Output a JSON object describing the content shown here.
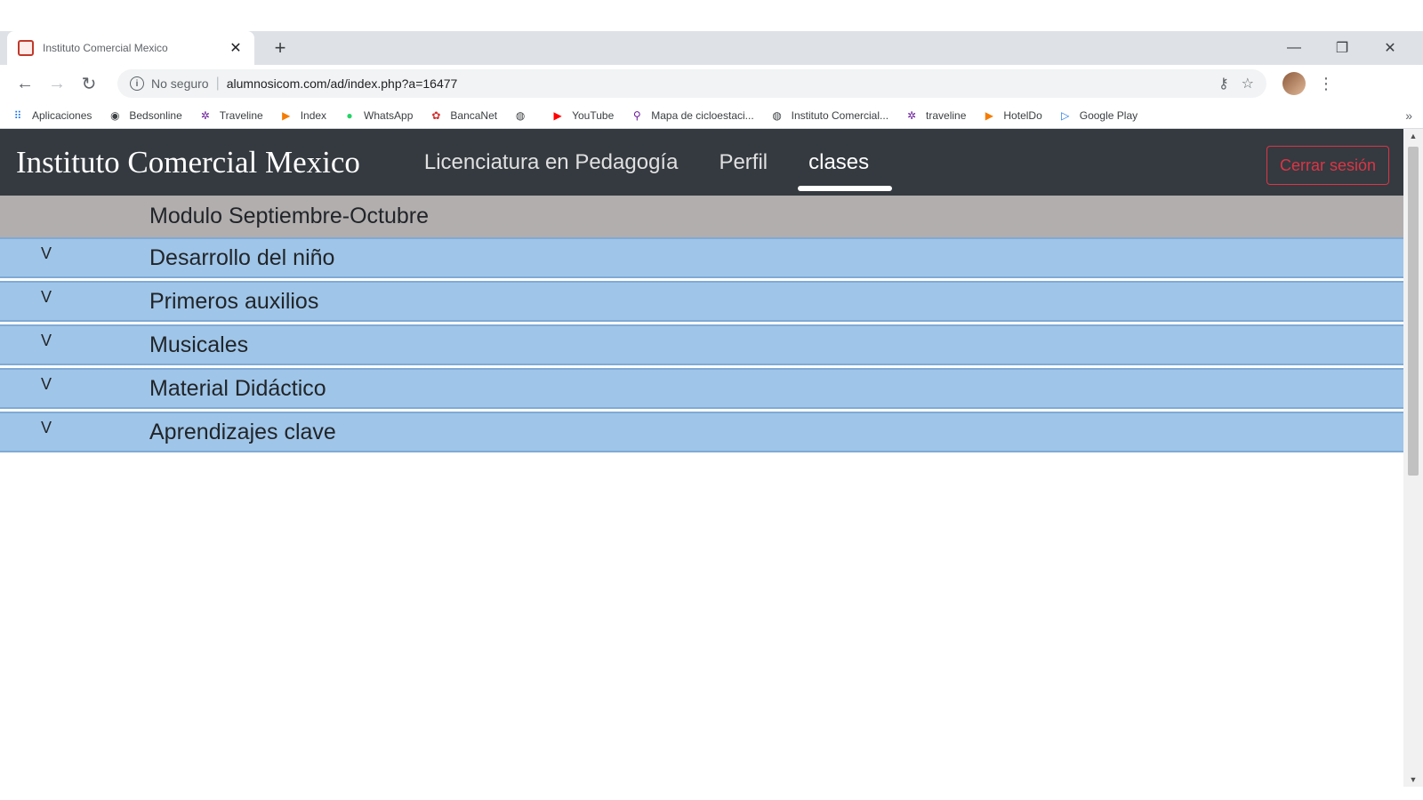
{
  "browser": {
    "tab": {
      "title": "Instituto Comercial Mexico",
      "close": "✕"
    },
    "new_tab": "+",
    "window_controls": {
      "minimize": "—",
      "restore": "❐",
      "close": "✕"
    },
    "nav": {
      "back": "←",
      "forward": "→",
      "reload": "↻"
    },
    "omnibox": {
      "info": "i",
      "security": "No seguro",
      "separator": "|",
      "url": "alumnosicom.com/ad/index.php?a=16477"
    },
    "icons": {
      "key": "⚷",
      "star": "☆",
      "menu": "⋮"
    },
    "bookmarks": [
      {
        "label": "Aplicaciones",
        "icon": "apps-icon",
        "glyph": "⠿",
        "color": "#1a73e8"
      },
      {
        "label": "Bedsonline",
        "icon": "pin-icon",
        "glyph": "◉",
        "color": "#3c4043"
      },
      {
        "label": "Traveline",
        "icon": "traveline-icon",
        "glyph": "✲",
        "color": "#6a1b9a"
      },
      {
        "label": "Index",
        "icon": "play-icon",
        "glyph": "▶",
        "color": "#f57c00"
      },
      {
        "label": "WhatsApp",
        "icon": "whatsapp-icon",
        "glyph": "●",
        "color": "#25d366"
      },
      {
        "label": "BancaNet",
        "icon": "bancanet-icon",
        "glyph": "✿",
        "color": "#d32f2f"
      },
      {
        "label": "",
        "icon": "globe-icon",
        "glyph": "◍",
        "color": "#3c4043"
      },
      {
        "label": "YouTube",
        "icon": "youtube-icon",
        "glyph": "▶",
        "color": "#ff0000"
      },
      {
        "label": "Mapa de cicloestaci...",
        "icon": "map-icon",
        "glyph": "⚲",
        "color": "#6a1b9a"
      },
      {
        "label": "Instituto Comercial...",
        "icon": "globe-icon",
        "glyph": "◍",
        "color": "#3c4043"
      },
      {
        "label": "traveline",
        "icon": "traveline-icon",
        "glyph": "✲",
        "color": "#6a1b9a"
      },
      {
        "label": "HotelDo",
        "icon": "play-icon",
        "glyph": "▶",
        "color": "#f57c00"
      },
      {
        "label": "Google Play",
        "icon": "google-play-icon",
        "glyph": "▷",
        "color": "#1a73e8"
      }
    ],
    "bookmarks_more": "»"
  },
  "site": {
    "brand": "Instituto Comercial Mexico",
    "nav_links": [
      {
        "label": "Licenciatura en Pedagogía",
        "active": false
      },
      {
        "label": "Perfil",
        "active": false
      },
      {
        "label": "clases",
        "active": true
      }
    ],
    "logout": "Cerrar sesión",
    "colors": {
      "navbar": "#343a40",
      "module_header": "#b2aeae",
      "course_row": "#9fc5e8",
      "logout": "#dc3545"
    }
  },
  "module": {
    "title": "Modulo Septiembre-Octubre",
    "chevron": "V",
    "courses": [
      "Desarrollo del niño",
      "Primeros auxilios",
      "Musicales",
      "Material Didáctico",
      "Aprendizajes clave"
    ]
  },
  "scrollbar": {
    "up": "▲",
    "down": "▼"
  }
}
